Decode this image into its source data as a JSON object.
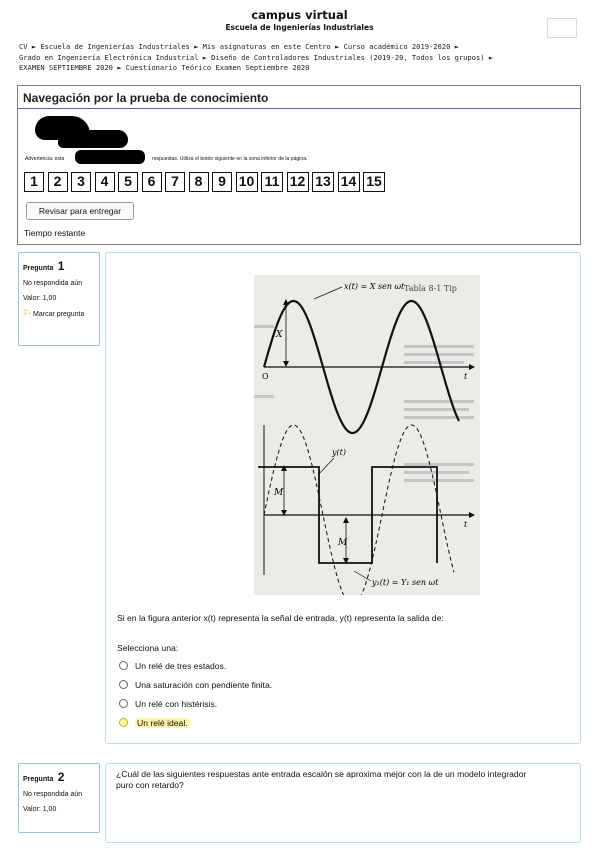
{
  "header": {
    "site_title": "campus virtual",
    "site_subtitle": "Escuela de Ingenierías Industriales"
  },
  "breadcrumb": {
    "line1": "CV ► Escuela de Ingenierías Industriales ► Mis asignaturas en este Centro ► Curso académico 2019-2020 ►",
    "line2": "Grado en Ingeniería Electrónica Industrial ► Diseño de Controladores Industriales (2019-20, Todos los grupos) ►",
    "line3": "EXAMEN SEPTIEMBRE 2020 ► Cuestionario Teórico Examen Septiembre 2020"
  },
  "navigation": {
    "title": "Navegación por la prueba de conocimiento",
    "warning_start": "Advertencia: esta",
    "warning_end": "respuestas. Utiliza el botón siguiente en la zona inferior de la página.",
    "question_numbers": [
      "1",
      "2",
      "3",
      "4",
      "5",
      "6",
      "7",
      "8",
      "9",
      "10",
      "11",
      "12",
      "13",
      "14",
      "15"
    ],
    "review_button": "Revisar para entregar",
    "time_label": "Tiempo restante"
  },
  "question1": {
    "word": "Pregunta",
    "number": "1",
    "state": "No respondida aún",
    "mark": "Valor: 1,00",
    "flag_label": "Marcar pregunta",
    "text": "Si en la figura anterior x(t) representa la señal de entrada, y(t) representa la salida de:",
    "prompt": "Selecciona una:",
    "options": [
      "Un relé de tres estados.",
      "Una saturación con pendiente finita.",
      "Un relé con histérisis.",
      "Un relé ideal."
    ],
    "figure": {
      "top_label": "x(t) = X sen ωt",
      "header_text": "Tabla 8-1 Tip",
      "x_amp": "X",
      "origin": "O",
      "t_axis": "t",
      "y_label": "y(t)",
      "m_upper": "M",
      "m_lower": "M",
      "y1_label": "y₁(t) = Y₁ sen ωt"
    }
  },
  "question2": {
    "word": "Pregunta",
    "number": "2",
    "state": "No respondida aún",
    "mark": "Valor: 1,00",
    "text": "¿Cuál de las siguientes respuestas ante entrada escalón se aproxima mejor con la de un modelo integrador puro con retardo?"
  },
  "colors": {
    "panel_border": "#6a5fa8",
    "question_border": "#9ec3d6",
    "flag": "#e5a500",
    "highlight": "#fcf6a6"
  }
}
